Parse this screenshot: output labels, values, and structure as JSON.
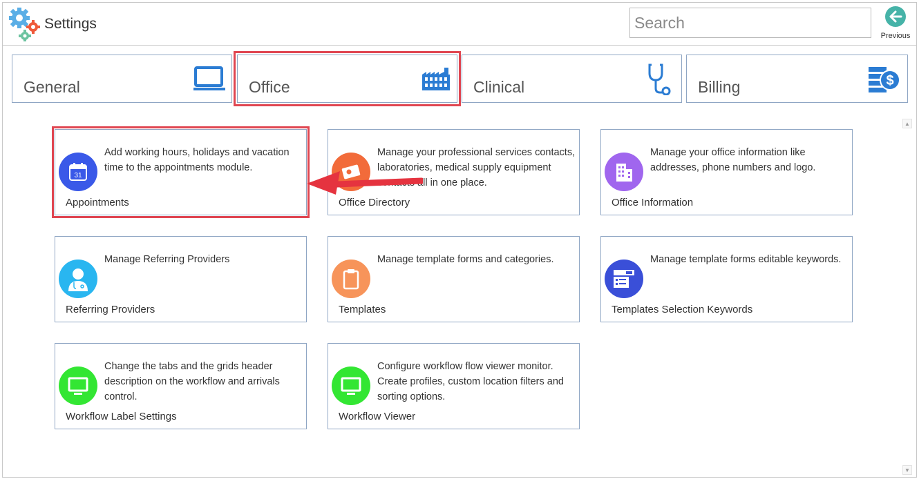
{
  "app": {
    "title": "Settings"
  },
  "search": {
    "placeholder": "Search"
  },
  "previous": {
    "label": "Previous"
  },
  "tabs": [
    {
      "label": "General",
      "icon": "monitor-icon"
    },
    {
      "label": "Office",
      "icon": "building-icon"
    },
    {
      "label": "Clinical",
      "icon": "stethoscope-icon"
    },
    {
      "label": "Billing",
      "icon": "billing-dollar-icon"
    }
  ],
  "selected_tab": "Office",
  "cards": [
    {
      "title": "Appointments",
      "desc": "Add working hours, holidays and vacation time to the appointments module.",
      "color": "#3a59e8",
      "icon": "calendar-icon",
      "calendar_day": "31"
    },
    {
      "title": "Office Directory",
      "desc": "Manage your professional services contacts, laboratories, medical supply equipment contacts all in one place.",
      "color": "#f26b3a",
      "icon": "contact-card-icon"
    },
    {
      "title": "Office Information",
      "desc": "Manage your office information like addresses, phone numbers and logo.",
      "color": "#a066ee",
      "icon": "office-building-icon"
    },
    {
      "title": "Referring Providers",
      "desc": "Manage Referring Providers",
      "color": "#29b6f0",
      "icon": "doctor-icon"
    },
    {
      "title": "Templates",
      "desc": "Manage template forms and categories.",
      "color": "#f7945a",
      "icon": "clipboard-icon"
    },
    {
      "title": "Templates Selection Keywords",
      "desc": "Manage template forms editable keywords.",
      "color": "#3a4fd8",
      "icon": "form-keywords-icon"
    },
    {
      "title": "Workflow Label Settings",
      "desc": "Change the tabs and the grids header description on the workflow and arrivals control.",
      "color": "#33e633",
      "icon": "monitor-icon"
    },
    {
      "title": "Workflow Viewer",
      "desc": "Configure workflow flow viewer monitor. Create profiles, custom location filters and sorting options.",
      "color": "#33e633",
      "icon": "monitor-icon"
    }
  ],
  "colors": {
    "accent": "#2b7cd3",
    "highlight": "#e04651",
    "border": "#8fa6c4",
    "prev": "#3fb0a0"
  }
}
